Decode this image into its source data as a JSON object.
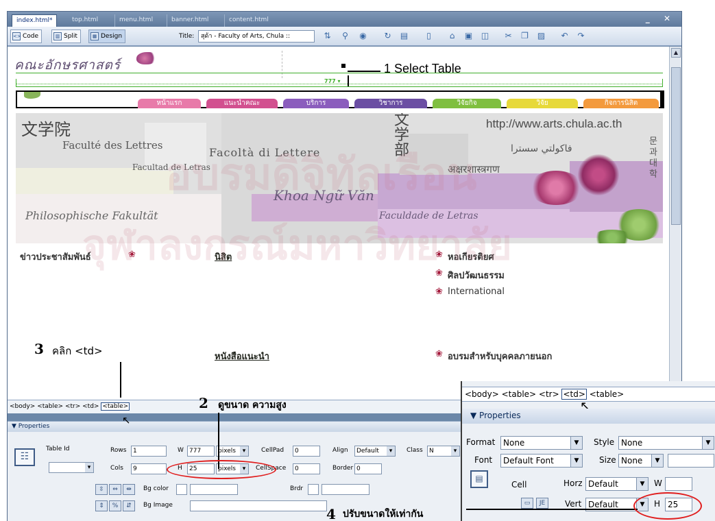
{
  "tabs": [
    {
      "label": "index.html*",
      "active": true
    },
    {
      "label": "top.html"
    },
    {
      "label": "menu.html"
    },
    {
      "label": "banner.html"
    },
    {
      "label": "content.html"
    }
  ],
  "window_controls": "_ ✕",
  "toolbar": {
    "code_label": "Code",
    "split_label": "Split",
    "design_label": "Design",
    "title_label": "Title:",
    "title_value": "สุด้า - Faculty of Arts, Chula ::"
  },
  "canvas": {
    "logo_text": "คณะอักษรศาสตร์",
    "ruler_width": "777 ▾",
    "nav_tabs": [
      {
        "label": "หน้าแรก",
        "color": "#e87aa9"
      },
      {
        "label": "แนะนำคณะ",
        "color": "#d2508f"
      },
      {
        "label": "บริการ",
        "color": "#8b5dbd"
      },
      {
        "label": "วิชาการ",
        "color": "#6b4ea3"
      },
      {
        "label": "วิจัยกิจ",
        "color": "#7fbf3f"
      },
      {
        "label": "วิจัย",
        "color": "#e7d93a"
      },
      {
        "label": "กิจการนิสิต",
        "color": "#f39a3d"
      }
    ],
    "banner": {
      "kanji_left": "文学院",
      "kanji_center": "文\n学\n部",
      "url": "http://www.arts.chula.ac.th",
      "french": "Faculté des Lettres",
      "italian": "Facoltà di Lettere",
      "spanish": "Facultad de Letras",
      "arabic": "فاكولتي سسترا",
      "hindi": "अक्षरशास्त्रगण",
      "vietnamese": "Khoa Ngữ Văn",
      "german": "Philosophische Fakultät",
      "portuguese": "Faculdade de Letras",
      "korean": "문\n과\n대\n학"
    },
    "content": {
      "news": "ข่าวประชาสัมพันธ์",
      "student": "นิสิต",
      "book": "หนังสือแนะนำ",
      "right_links": [
        "หอเกียรติยศ",
        "ศิลปวัฒนธรรม",
        "International",
        "อบรมสำหรับบุคคลภายนอก"
      ]
    },
    "watermark1": "อบรมดิจิทัลเรือน",
    "watermark2": "จุฬาลงกรณ์มหาวิทยาลัย"
  },
  "tag_selector": {
    "before": "<body> <table> <tr> ",
    "td": "<td>",
    "after": " ",
    "table": "<table>"
  },
  "properties": {
    "header": "▼ Properties",
    "table_id_label": "Table Id",
    "rows_label": "Rows",
    "rows_value": "1",
    "cols_label": "Cols",
    "cols_value": "9",
    "w_label": "W",
    "w_value": "777",
    "w_unit": "pixels",
    "h_label": "H",
    "h_value": "25",
    "h_unit": "pixels",
    "cellpad_label": "CellPad",
    "cellpad_value": "0",
    "cellspace_label": "CellSpace",
    "cellspace_value": "0",
    "align_label": "Align",
    "align_value": "Default",
    "border_label": "Border",
    "border_value": "0",
    "class_label": "Class",
    "class_value": "N",
    "bgcolor_label": "Bg color",
    "brdr_label": "Brdr",
    "bgimage_label": "Bg Image"
  },
  "annotations": {
    "step1": "1 Select Table",
    "step2_num": "2",
    "step2_text": "ดูขนาด ความสูง",
    "step3_num": "3",
    "step3_text": "คลิก <td>",
    "step4_num": "4",
    "step4_text": "ปรับขนาดให้เท่ากัน"
  },
  "inset": {
    "tags_before": "<body> <table> <tr> ",
    "tags_td": "<td>",
    "tags_after": " <table>",
    "prop_header": "▼ Properties",
    "format_label": "Format",
    "format_value": "None",
    "style_label": "Style",
    "style_value": "None",
    "font_label": "Font",
    "font_value": "Default Font",
    "size_label": "Size",
    "size_value": "None",
    "cell_label": "Cell",
    "horz_label": "Horz",
    "horz_value": "Default",
    "w_label": "W",
    "vert_label": "Vert",
    "vert_value": "Default",
    "h_label": "H",
    "h_value": "25"
  }
}
